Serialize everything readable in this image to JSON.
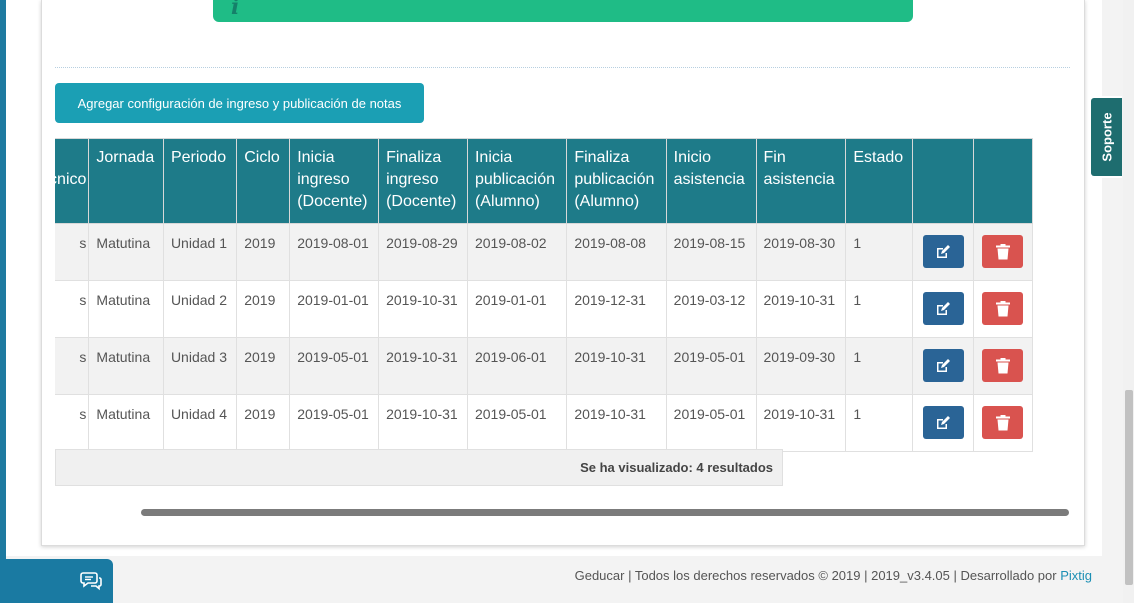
{
  "toolbar": {
    "add_button_label": "Agregar configuración de ingreso y publicación de notas"
  },
  "table": {
    "headers": [
      "Técnico",
      "Jornada",
      "Periodo",
      "Ciclo",
      "Inicia ingreso (Docente)",
      "Finaliza ingreso (Docente)",
      "Inicia publicación (Alumno)",
      "Finaliza publicación (Alumno)",
      "Inicio asistencia",
      "Fin asistencia",
      "Estado",
      "",
      ""
    ],
    "rows": [
      {
        "first_col": "s",
        "jornada": "Matutina",
        "periodo": "Unidad 1",
        "ciclo": "2019",
        "inicia_ingreso": "2019-08-01",
        "finaliza_ingreso": "2019-08-29",
        "inicia_publicacion": "2019-08-02",
        "finaliza_publicacion": "2019-08-08",
        "inicio_asistencia": "2019-08-15",
        "fin_asistencia": "2019-08-30",
        "estado": "1"
      },
      {
        "first_col": "s",
        "jornada": "Matutina",
        "periodo": "Unidad 2",
        "ciclo": "2019",
        "inicia_ingreso": "2019-01-01",
        "finaliza_ingreso": "2019-10-31",
        "inicia_publicacion": "2019-01-01",
        "finaliza_publicacion": "2019-12-31",
        "inicio_asistencia": "2019-03-12",
        "fin_asistencia": "2019-10-31",
        "estado": "1"
      },
      {
        "first_col": "s",
        "jornada": "Matutina",
        "periodo": "Unidad 3",
        "ciclo": "2019",
        "inicia_ingreso": "2019-05-01",
        "finaliza_ingreso": "2019-10-31",
        "inicia_publicacion": "2019-06-01",
        "finaliza_publicacion": "2019-10-31",
        "inicio_asistencia": "2019-05-01",
        "fin_asistencia": "2019-09-30",
        "estado": "1"
      },
      {
        "first_col": "s",
        "jornada": "Matutina",
        "periodo": "Unidad 4",
        "ciclo": "2019",
        "inicia_ingreso": "2019-05-01",
        "finaliza_ingreso": "2019-10-31",
        "inicia_publicacion": "2019-05-01",
        "finaliza_publicacion": "2019-10-31",
        "inicio_asistencia": "2019-05-01",
        "fin_asistencia": "2019-10-31",
        "estado": "1"
      }
    ],
    "row_actions": {
      "edit_icon": "edit-icon",
      "delete_icon": "trash-icon"
    },
    "result_count_text": "Se ha visualizado: 4 resultados"
  },
  "footer": {
    "text": "Geducar | Todos los derechos reservados © 2019 | 2019_v3.4.05 | Desarrollado por ",
    "link": "Pixtig"
  },
  "support_tab": {
    "label": "Soporte"
  },
  "chat_tab": {
    "icon": "chat-icon"
  },
  "colors": {
    "table_header": "#1e7b89",
    "add_button": "#1b9fb4",
    "alert_bar": "#1fbc86",
    "edit_button": "#2a6496",
    "delete_button": "#d9534f",
    "support_tab": "#1e6d6f",
    "chat_tab": "#1a7aa2",
    "link": "#1b8fb4"
  }
}
